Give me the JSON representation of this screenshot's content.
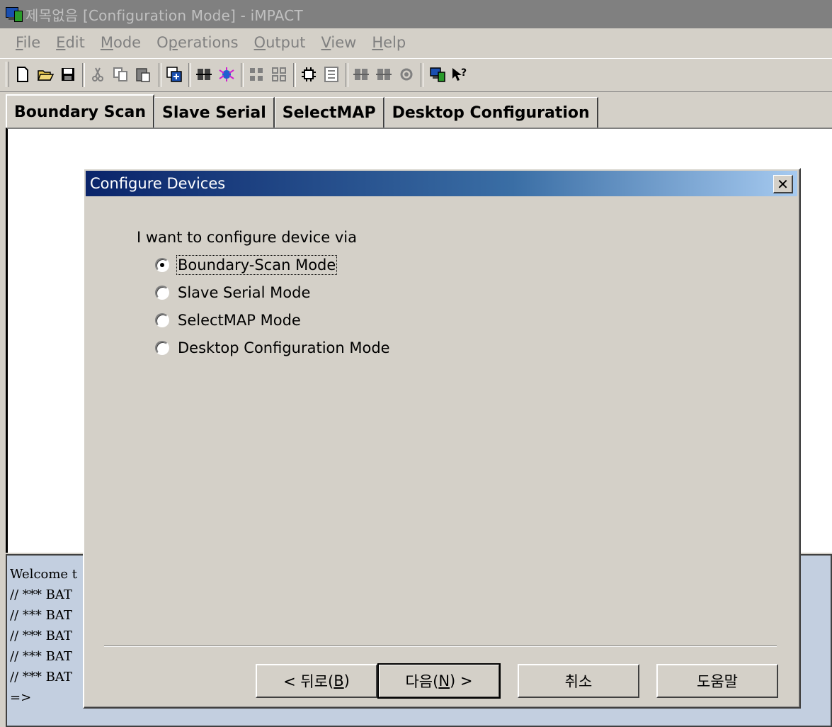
{
  "window": {
    "title": "제목없음 [Configuration Mode]  - iMPACT"
  },
  "menu": {
    "items": [
      {
        "mnemonic": "F",
        "rest": "ile"
      },
      {
        "mnemonic": "E",
        "rest": "dit"
      },
      {
        "mnemonic": "M",
        "rest": "ode"
      },
      {
        "pre": "O",
        "mnemonic": "p",
        "rest": "erations"
      },
      {
        "mnemonic": "O",
        "rest": "utput"
      },
      {
        "mnemonic": "V",
        "rest": "iew"
      },
      {
        "mnemonic": "H",
        "rest": "elp"
      }
    ]
  },
  "toolbar": {
    "icons": [
      "new-icon",
      "open-icon",
      "save-icon",
      "cut-icon",
      "copy-icon",
      "paste-icon",
      "device-program-icon",
      "chain-icon",
      "bug-icon",
      "grid-icon",
      "grid-outline-icon",
      "chip-icon",
      "list-icon",
      "chain-left-icon",
      "chain-right-icon",
      "gear-icon",
      "impact-icon",
      "context-help-icon"
    ]
  },
  "tabs": [
    "Boundary Scan",
    "Slave Serial",
    "SelectMAP",
    "Desktop Configuration"
  ],
  "console": {
    "lines": [
      "Welcome t",
      "// *** BAT",
      "// *** BAT",
      "// *** BAT",
      "// *** BAT",
      "// *** BAT",
      "=>"
    ]
  },
  "dialog": {
    "title": "Configure Devices",
    "close_label": "✕",
    "prompt": "I want to configure device via",
    "options": [
      {
        "label": "Boundary-Scan Mode",
        "checked": true
      },
      {
        "label": "Slave Serial Mode",
        "checked": false
      },
      {
        "label": "SelectMAP Mode",
        "checked": false
      },
      {
        "label": "Desktop Configuration Mode",
        "checked": false
      }
    ],
    "buttons": {
      "back": {
        "pre": "< 뒤로(",
        "mnemonic": "B",
        "post": ")"
      },
      "next": {
        "pre": "다음(",
        "mnemonic": "N",
        "post": ") >"
      },
      "cancel": "취소",
      "help": "도움말"
    }
  },
  "colors": {
    "face": "#d4d0c8",
    "title_inactive": "#808080",
    "dialog_title_start": "#0a246a",
    "dialog_title_end": "#a6caf0",
    "console_bg": "#c3cfe0"
  }
}
